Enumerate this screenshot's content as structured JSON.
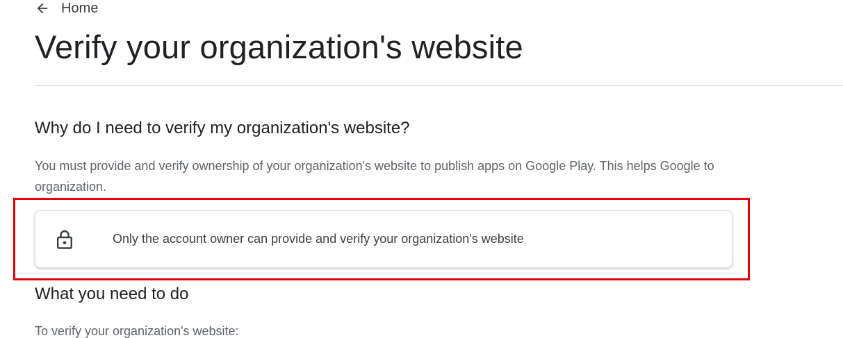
{
  "breadcrumb": {
    "back_icon": "arrow-back-icon",
    "label": "Home"
  },
  "page": {
    "title": "Verify your organization's website"
  },
  "why_section": {
    "heading": "Why do I need to verify my organization's website?",
    "body_line1": "You must provide and verify ownership of your organization's website to publish apps on Google Play. This helps Google to",
    "body_line2": "organization."
  },
  "notice": {
    "icon": "lock-icon",
    "text": "Only the account owner can provide and verify your organization's website"
  },
  "what_section": {
    "heading": "What you need to do",
    "body": "To verify your organization's website:"
  },
  "colors": {
    "highlight_border": "#e3000f",
    "text_primary": "#202124",
    "text_secondary": "#5f6368",
    "divider": "#dadce0"
  }
}
